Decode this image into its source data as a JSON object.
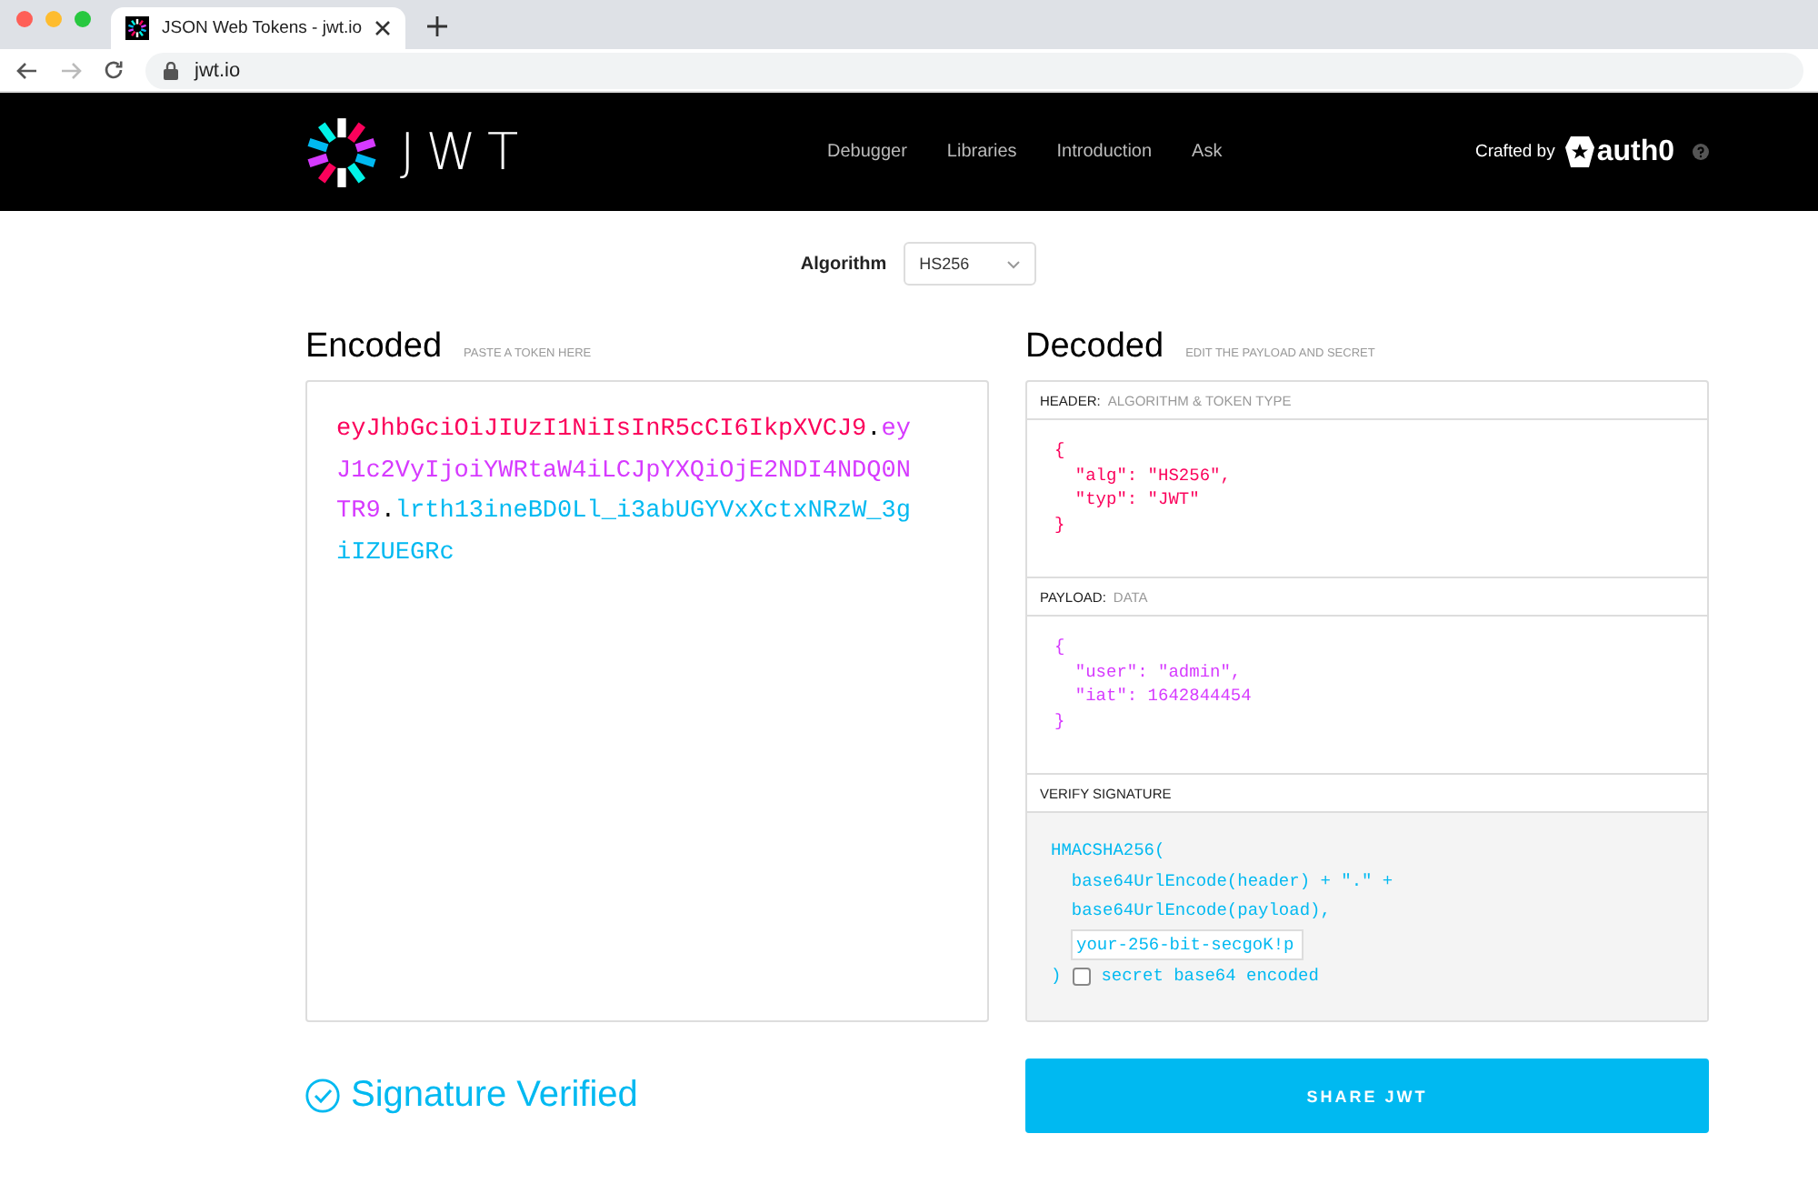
{
  "browser": {
    "tab": {
      "title": "JSON Web Tokens - jwt.io",
      "selected": true
    },
    "address": "jwt.io"
  },
  "nav": {
    "logo_text": "JWT",
    "links": [
      "Debugger",
      "Libraries",
      "Introduction",
      "Ask"
    ],
    "crafted_by": "Crafted by",
    "brand": "auth0"
  },
  "algorithm": {
    "label": "Algorithm",
    "value": "HS256"
  },
  "encoded": {
    "title": "Encoded",
    "hint": "PASTE A TOKEN HERE",
    "lines": [
      [
        {
          "text": "eyJhbGciOiJIUzI1NiIsInR5cCI6IkpXVCJ9",
          "color": "#fb015b"
        },
        {
          "text": ".",
          "color": "#000000"
        },
        {
          "text": "ey",
          "color": "#d63aff"
        }
      ],
      [
        {
          "text": "J1c2VyIjoiYWRtaW4iLCJpYXQiOjE2NDI4NDQ0N",
          "color": "#d63aff"
        }
      ],
      [
        {
          "text": "TR9",
          "color": "#d63aff"
        },
        {
          "text": ".",
          "color": "#000000"
        },
        {
          "text": "lrth13ineBD0Ll_i3abUGYVxXctxNRzW_3g",
          "color": "#00b9f1"
        }
      ],
      [
        {
          "text": "iIZUEGRc",
          "color": "#00b9f1"
        }
      ]
    ]
  },
  "decoded": {
    "title": "Decoded",
    "hint": "EDIT THE PAYLOAD AND SECRET",
    "sections": [
      {
        "kind": "code",
        "label": "HEADER:",
        "sublabel": "ALGORITHM & TOKEN TYPE",
        "color": "#fb015b",
        "lines": [
          "{",
          "  \"alg\": \"HS256\",",
          "  \"typ\": \"JWT\"",
          "}"
        ]
      },
      {
        "kind": "code",
        "label": "PAYLOAD:",
        "sublabel": "DATA",
        "color": "#d63aff",
        "lines": [
          "{",
          "  \"user\": \"admin\",",
          "  \"iat\": 1642844454",
          "}"
        ]
      },
      {
        "kind": "verify",
        "label": "VERIFY SIGNATURE",
        "color": "#00b9f1",
        "lines": [
          "HMACSHA256(",
          "  base64UrlEncode(header) + \".\" +",
          "  base64UrlEncode(payload),"
        ],
        "secret": "your-256-bit-secgoK!p",
        "close": ")",
        "base64_label": "secret base64 encoded",
        "base64_checked": false
      }
    ]
  },
  "status": {
    "text": "Signature Verified",
    "verified": true
  },
  "share_button": "SHARE JWT"
}
